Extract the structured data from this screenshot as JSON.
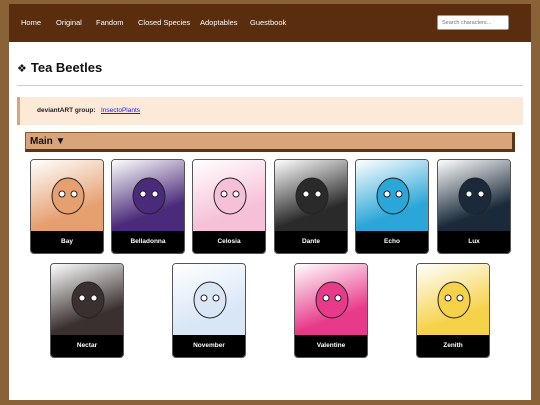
{
  "nav": {
    "items": [
      "Home",
      "Original",
      "Fandom",
      "Closed Species",
      "Adoptables",
      "Guestbook"
    ],
    "search_placeholder": "Search characters..."
  },
  "header": {
    "title_icon": "❖",
    "title": "Tea Beetles"
  },
  "notice": {
    "label": "deviantART group:",
    "link": "InsectoPlants"
  },
  "section": {
    "label": "Main ▼"
  },
  "characters": [
    {
      "name": "Bay",
      "color": "#e6a070"
    },
    {
      "name": "Belladonna",
      "color": "#4a2a7a"
    },
    {
      "name": "Celosia",
      "color": "#f6c0d8"
    },
    {
      "name": "Dante",
      "color": "#2a2a2a"
    },
    {
      "name": "Echo",
      "color": "#2aa6d8"
    },
    {
      "name": "Lux",
      "color": "#1a2a3a"
    },
    {
      "name": "Nectar",
      "color": "#3a3030"
    },
    {
      "name": "November",
      "color": "#d8e6f6"
    },
    {
      "name": "Valentine",
      "color": "#e83a8a"
    },
    {
      "name": "Zenith",
      "color": "#f6d24a"
    }
  ]
}
